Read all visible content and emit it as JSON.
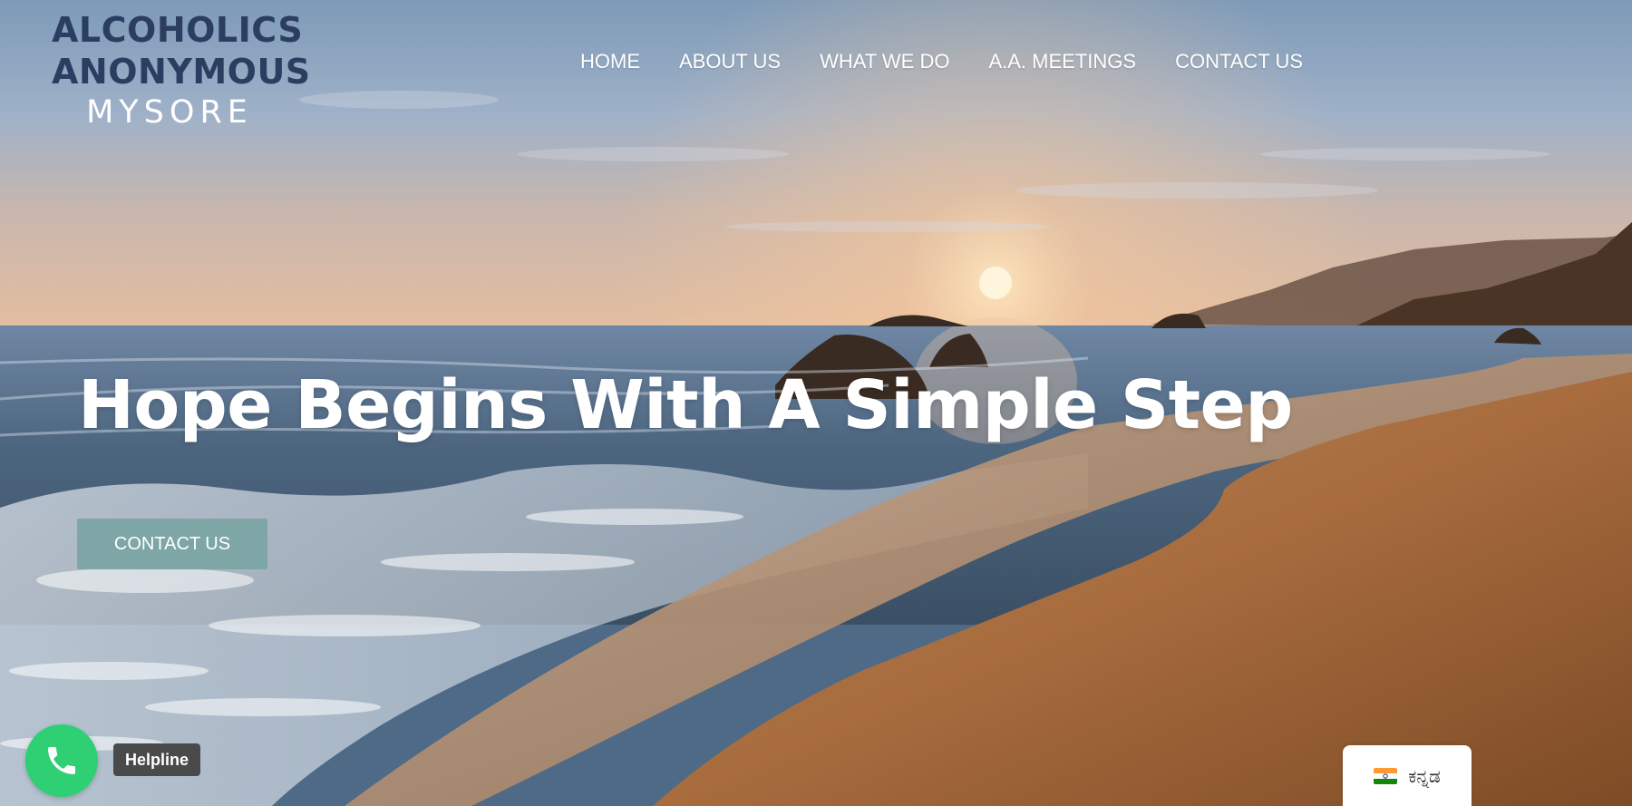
{
  "logo": {
    "line1": "ALCOHOLICS",
    "line2": "ANONYMOUS",
    "line3": "MYSORE"
  },
  "nav": {
    "items": [
      {
        "label": "HOME"
      },
      {
        "label": "ABOUT US"
      },
      {
        "label": "WHAT WE DO"
      },
      {
        "label": "A.A. MEETINGS"
      },
      {
        "label": "CONTACT US"
      }
    ]
  },
  "hero": {
    "headline": "Hope Begins With A Simple Step",
    "cta_label": "CONTACT US"
  },
  "helpline": {
    "label": "Helpline",
    "icon": "phone-icon"
  },
  "language": {
    "label": "ಕನ್ನಡ",
    "flag": "india-flag-icon"
  },
  "colors": {
    "logo_text": "#2b3e62",
    "cta_bg": "#7fa6a7",
    "helpline_green": "#2fcf74",
    "helpline_label_bg": "#4a4a4a"
  }
}
